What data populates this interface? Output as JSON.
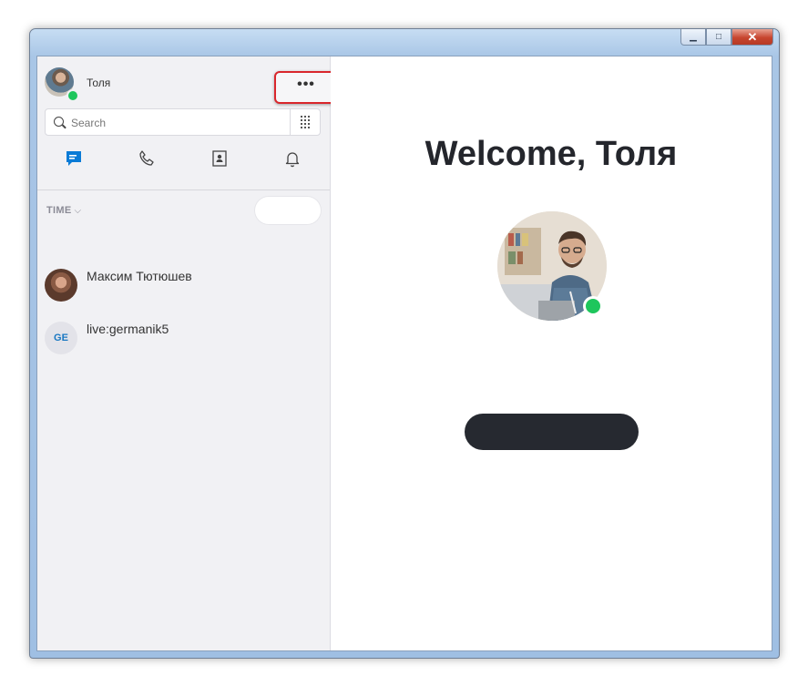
{
  "window": {
    "controls": {
      "minimize": "▁",
      "maximize": "□",
      "close": "✕"
    }
  },
  "sidebar": {
    "profile": {
      "name": "Толя",
      "status": "online",
      "status_color": "#1ec65c"
    },
    "more_button": {
      "label": "•••",
      "highlight_color": "#d9262c"
    },
    "search": {
      "placeholder": "Search",
      "value": ""
    },
    "dialpad_icon": "dialpad-icon",
    "tabs": [
      {
        "name": "chats",
        "icon": "chat-icon",
        "active": true,
        "color": "#0a7bd6"
      },
      {
        "name": "calls",
        "icon": "phone-icon",
        "active": false
      },
      {
        "name": "contacts",
        "icon": "contacts-icon",
        "active": false
      },
      {
        "name": "notifications",
        "icon": "bell-icon",
        "active": false
      }
    ],
    "sort": {
      "label": "TIME",
      "chevron": "⌵"
    },
    "chats": [
      {
        "name": "Максим Тютюшев",
        "avatar": "photo"
      },
      {
        "name": "live:germanik5",
        "avatar_initials": "GE"
      }
    ]
  },
  "main": {
    "welcome": "Welcome, Толя",
    "status_color": "#1ec65c"
  }
}
